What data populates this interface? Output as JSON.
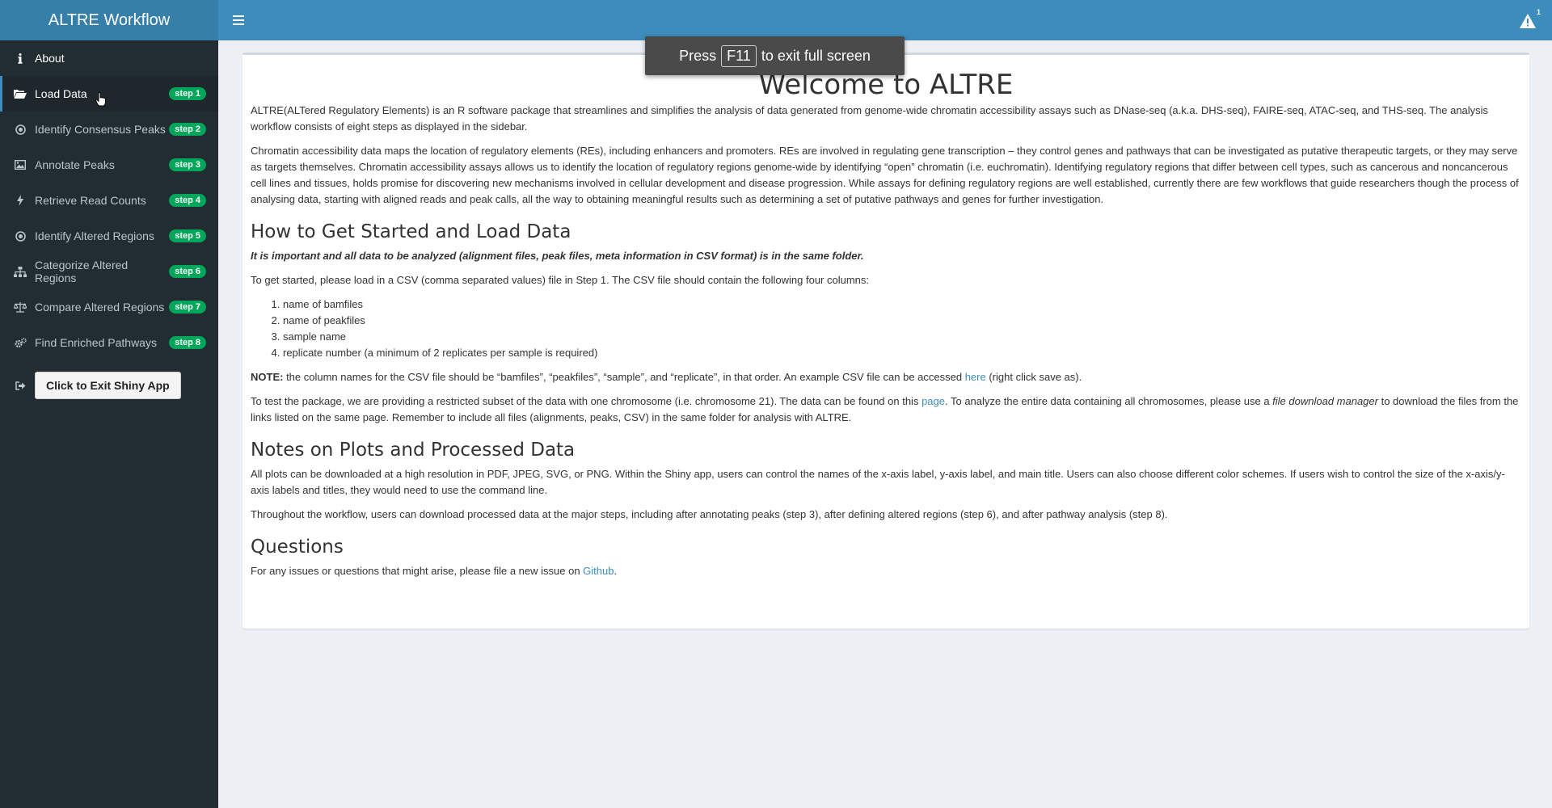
{
  "header": {
    "title": "ALTRE Workflow",
    "notification_count": "1"
  },
  "sidebar": {
    "items": [
      {
        "label": "About",
        "icon": "info-icon",
        "badge": ""
      },
      {
        "label": "Load Data",
        "icon": "folder-open-icon",
        "badge": "step 1"
      },
      {
        "label": "Identify Consensus Peaks",
        "icon": "bullseye-icon",
        "badge": "step 2"
      },
      {
        "label": "Annotate Peaks",
        "icon": "image-icon",
        "badge": "step 3"
      },
      {
        "label": "Retrieve Read Counts",
        "icon": "bolt-icon",
        "badge": "step 4"
      },
      {
        "label": "Identify Altered Regions",
        "icon": "bullseye-icon",
        "badge": "step 5"
      },
      {
        "label": "Categorize Altered Regions",
        "icon": "sitemap-icon",
        "badge": "step 6"
      },
      {
        "label": "Compare Altered Regions",
        "icon": "balance-scale-icon",
        "badge": "step 7"
      },
      {
        "label": "Find Enriched Pathways",
        "icon": "cogs-icon",
        "badge": "step 8"
      }
    ],
    "exit_button": "Click to Exit Shiny App"
  },
  "fullscreen_notice": {
    "press": "Press",
    "key": "F11",
    "rest": "to exit full screen"
  },
  "main": {
    "title": "Welcome to ALTRE",
    "intro_p1": "ALTRE(ALTered Regulatory Elements) is an R software package that streamlines and simplifies the analysis of data generated from genome-wide chromatin accessibility assays such as DNase-seq (a.k.a. DHS-seq), FAIRE-seq, ATAC-seq, and THS-seq. The analysis workflow consists of eight steps as displayed in the sidebar.",
    "intro_p2": "Chromatin accessibility data maps the location of regulatory elements (REs), including enhancers and promoters. REs are involved in regulating gene transcription – they control genes and pathways that can be investigated as putative therapeutic targets, or they may serve as targets themselves. Chromatin accessibility assays allows us to identify the location of regulatory regions genome-wide by identifying “open” chromatin (i.e. euchromatin). Identifying regulatory regions that differ between cell types, such as cancerous and noncancerous cell lines and tissues, holds promise for discovering new mechanisms involved in cellular development and disease progression. While assays for defining regulatory regions are well established, currently there are few workflows that guide researchers though the process of analysing data, starting with aligned reads and peak calls, all the way to obtaining meaningful results such as determining a set of putative pathways and genes for further investigation.",
    "section1_title": "How to Get Started and Load Data",
    "important_note": "It is important and all data to be analyzed (alignment files, peak files, meta information in CSV format) is in the same folder.",
    "getstarted": "To get started, please load in a CSV (comma separated values) file in Step 1. The CSV file should contain the following four columns:",
    "columns": [
      "name of bamfiles",
      "name of peakfiles",
      "sample name",
      "replicate number (a minimum of 2 replicates per sample is required)"
    ],
    "note_label": "NOTE:",
    "note_text": " the column names for the CSV file should be “bamfiles”, “peakfiles”, “sample”, and “replicate”, in that order. An example CSV file can be accessed ",
    "note_link": "here",
    "note_tail": " (right click save as).",
    "test_text": "To test the package, we are providing a restricted subset of the data with one chromosome (i.e. chromosome 21). The data can be found on this ",
    "test_link": "page",
    "test_mid": ". To analyze the entire data containing all chromosomes, please use a ",
    "test_em": "file download manager",
    "test_tail": " to download the files from the links listed on the same page. Remember to include all files (alignments, peaks, CSV) in the same folder for analysis with ALTRE.",
    "section2_title": "Notes on Plots and Processed Data",
    "plots_p1": "All plots can be downloaded at a high resolution in PDF, JPEG, SVG, or PNG. Within the Shiny app, users can control the names of the x-axis label, y-axis label, and main title. Users can also choose different color schemes. If users wish to control the size of the x-axis/y-axis labels and titles, they would need to use the command line.",
    "plots_p2": "Throughout the workflow, users can download processed data at the major steps, including after annotating peaks (step 3), after defining altered regions (step 6), and after pathway analysis (step 8).",
    "section3_title": "Questions",
    "questions_text": "For any issues or questions that might arise, please file a new issue on ",
    "questions_link": "Github",
    "questions_tail": "."
  },
  "colors": {
    "header": "#3c8dbc",
    "logo": "#367fa9",
    "sidebar": "#222d32",
    "badge": "#00a65a",
    "link": "#3c8dbc"
  }
}
